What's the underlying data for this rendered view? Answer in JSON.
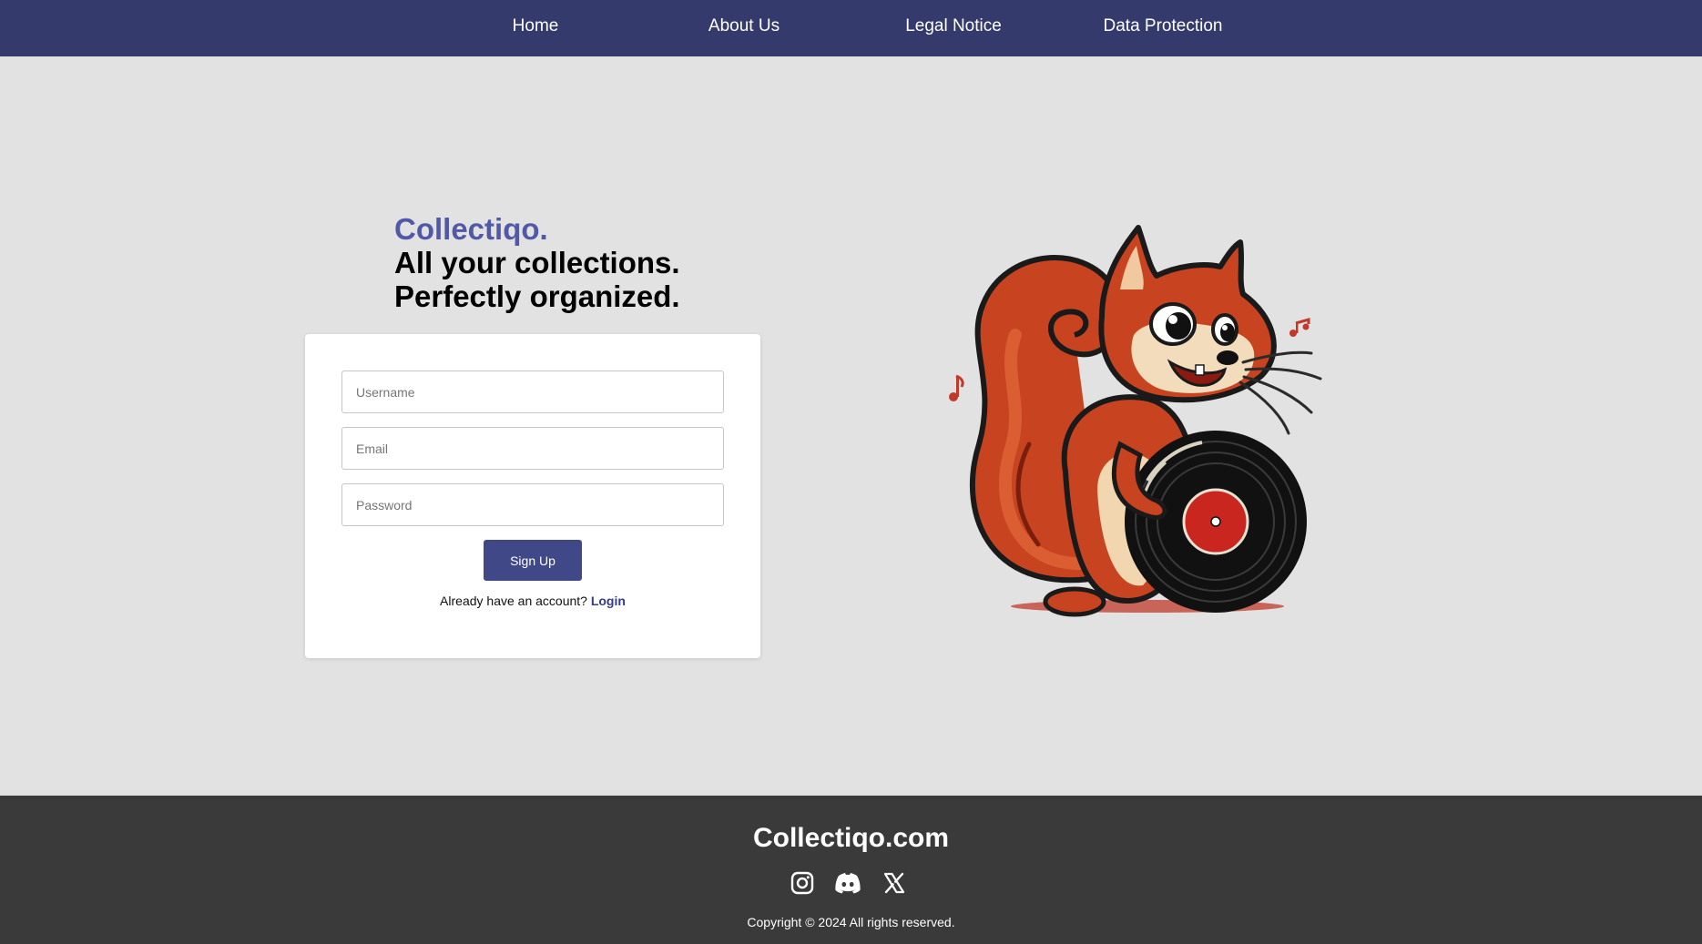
{
  "nav": {
    "items": [
      {
        "label": "Home"
      },
      {
        "label": "About Us"
      },
      {
        "label": "Legal Notice"
      },
      {
        "label": "Data Protection"
      }
    ]
  },
  "hero": {
    "brand": "Collectiqo.",
    "line1": "All your collections.",
    "line2": "Perfectly organized."
  },
  "form": {
    "username_placeholder": "Username",
    "email_placeholder": "Email",
    "password_placeholder": "Password",
    "signup_label": "Sign Up",
    "login_prompt": "Already have an account?",
    "login_label": "Login"
  },
  "footer": {
    "title": "Collectiqo.com",
    "social_icons": [
      "instagram-icon",
      "discord-icon",
      "x-icon"
    ],
    "copyright": "Copyright © 2024 All rights reserved."
  },
  "colors": {
    "nav_bg": "#353a6d",
    "brand_accent": "#5158a8",
    "button_bg": "#404888",
    "page_bg": "#e2e2e2",
    "footer_bg": "#3a3a3a"
  }
}
